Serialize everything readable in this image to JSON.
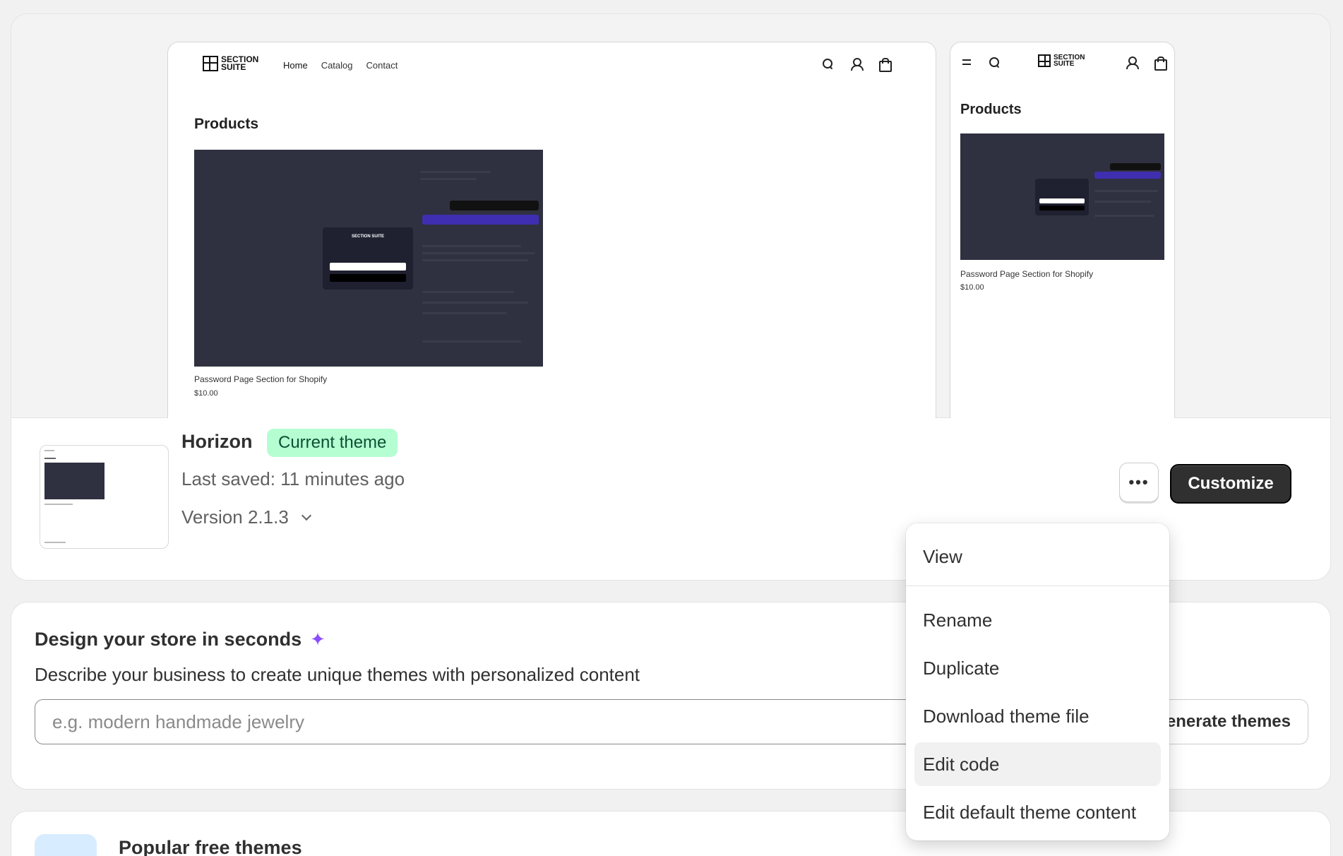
{
  "preview": {
    "logo_text": "SECTION SUITE",
    "nav": [
      "Home",
      "Catalog",
      "Contact"
    ],
    "products_heading": "Products",
    "product_name": "Password Page Section for Shopify",
    "product_price": "$10.00"
  },
  "theme": {
    "name": "Horizon",
    "badge": "Current theme",
    "last_saved": "Last saved: 11 minutes ago",
    "version": "Version 2.1.3",
    "more_label": "•••",
    "customize_label": "Customize"
  },
  "design": {
    "title": "Design your store in seconds",
    "sparkle": "✦",
    "subtitle": "Describe your business to create unique themes with personalized content",
    "input_placeholder": "e.g. modern handmade jewelry",
    "generate_label": "enerate themes"
  },
  "popular": {
    "title": "Popular free themes"
  },
  "menu": {
    "items": [
      "View",
      "Rename",
      "Duplicate",
      "Download theme file",
      "Edit code",
      "Edit default theme content"
    ],
    "active_item": "Edit code"
  }
}
